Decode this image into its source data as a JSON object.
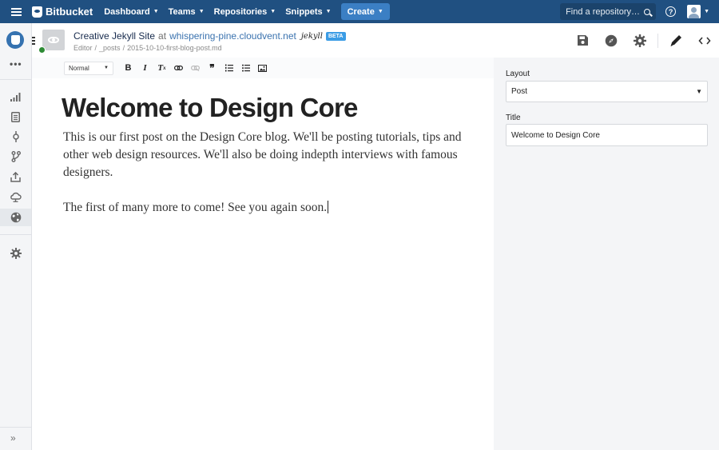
{
  "topnav": {
    "brand": "Bitbucket",
    "items": [
      {
        "label": "Dashboard"
      },
      {
        "label": "Teams"
      },
      {
        "label": "Repositories"
      },
      {
        "label": "Snippets"
      }
    ],
    "create_label": "Create",
    "search_placeholder": "Find a repository…",
    "help_glyph": "?",
    "colors": {
      "bar": "#205081",
      "create": "#3b7fc4"
    }
  },
  "sidebar": {
    "icons": [
      "repo-avatar",
      "more-icon",
      "overview-icon",
      "source-icon",
      "commits-icon",
      "branches-icon",
      "deploy-icon",
      "cloud-icon",
      "globe-icon",
      "settings-icon",
      "expand-icon"
    ],
    "more_glyph": "•••",
    "expand_glyph": "»"
  },
  "header": {
    "site_name": "Creative Jekyll Site",
    "at": "at",
    "domain": "whispering-pine.cloudvent.net",
    "jekyll_logo_text": "jekyll",
    "beta_badge": "BETA",
    "breadcrumb": [
      "Editor",
      "_posts",
      "2015-10-10-first-blog-post.md"
    ],
    "breadcrumb_sep": "/",
    "actions": [
      "save-icon",
      "compass-icon",
      "gear-icon",
      "pencil-icon",
      "code-icon"
    ]
  },
  "editor": {
    "format_select": "Normal",
    "toolbar_glyphs": {
      "bold": "B",
      "italic": "I",
      "clear": "T",
      "clear_sub": "x",
      "quote": "❞"
    },
    "heading": "Welcome to Design Core",
    "paragraphs": [
      "This is our first post on the Design Core blog. We'll be posting tutorials, tips and other web design resources. We'll also be doing indepth interviews with famous designers.",
      "The first of many more to come! See you again soon."
    ]
  },
  "panel": {
    "layout_label": "Layout",
    "layout_value": "Post",
    "title_label": "Title",
    "title_value": "Welcome to Design Core"
  }
}
